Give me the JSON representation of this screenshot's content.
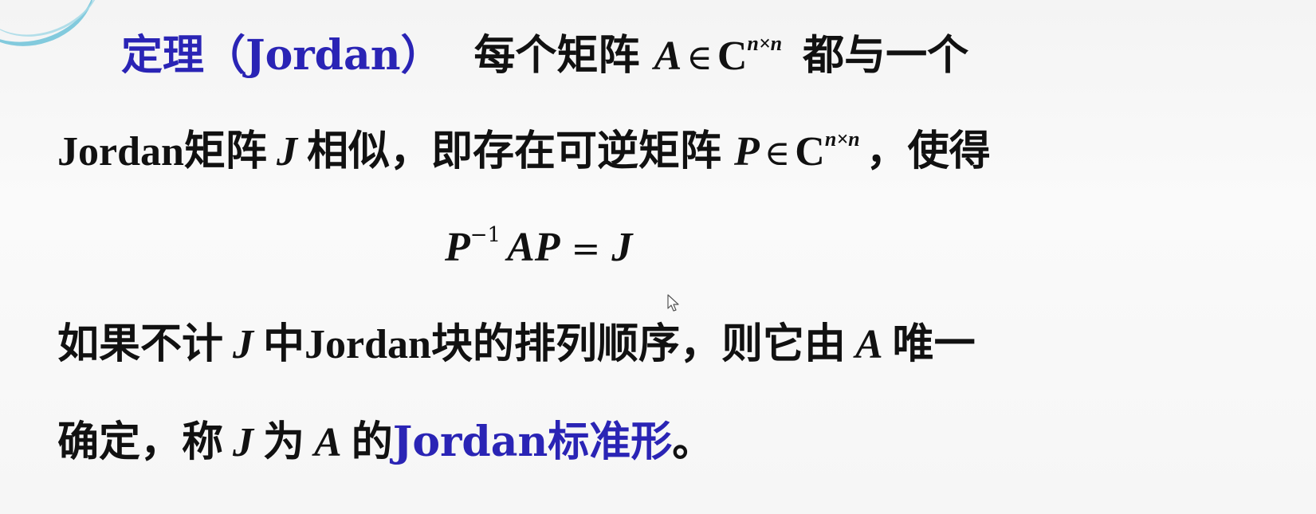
{
  "theorem": {
    "label": "定理（Jordan）",
    "line1": {
      "text_a": "每个矩阵",
      "mat_a": "A",
      "in_sym": "∈",
      "field": "C",
      "dim": "n×n",
      "text_b": "都与一个"
    },
    "line2": {
      "word_jordan": "Jordan",
      "text_a": "矩阵",
      "mat_j": "J",
      "text_b": "相似，即存在可逆矩阵",
      "mat_p": "P",
      "in_sym": "∈",
      "field": "C",
      "dim": "n×n",
      "text_c": "，使得"
    },
    "formula": {
      "p": "P",
      "exp": "−1",
      "ap": "AP",
      "eq": "=",
      "j": "J"
    },
    "line3": {
      "text_a": "如果不计",
      "mat_j": "J",
      "text_b": "中",
      "word_jordan": "Jordan",
      "text_c": "块的排列顺序，则它由",
      "mat_a": "A",
      "text_d": "唯一"
    },
    "line4": {
      "text_a": "确定，称",
      "mat_j": "J",
      "text_b": "为",
      "mat_a": "A",
      "text_c": "的",
      "term": "Jordan标准形",
      "text_d": "。"
    }
  },
  "colors": {
    "accent": "#2a24b5",
    "text": "#111111",
    "swoosh": "#6fc3d9"
  },
  "icons": {
    "cursor": "mouse-pointer-icon"
  }
}
